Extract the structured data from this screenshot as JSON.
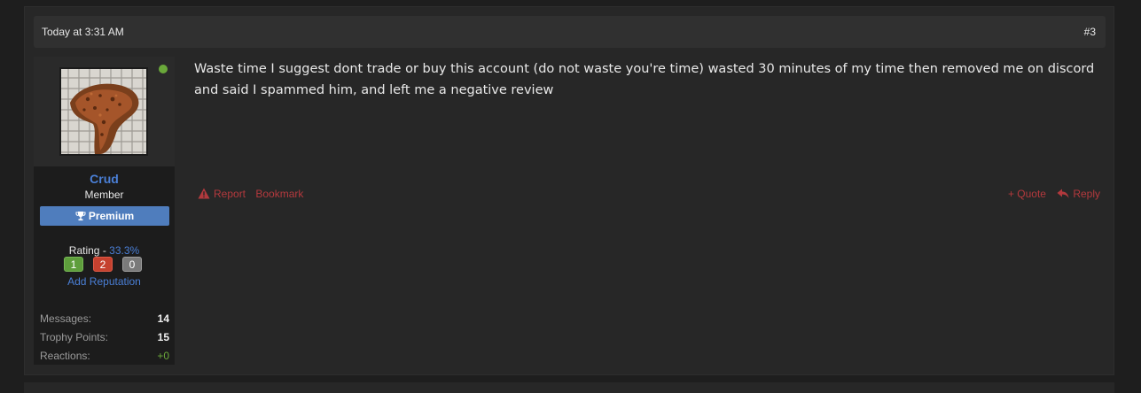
{
  "post": {
    "date": "Today at 3:31 AM",
    "number": "#3",
    "body": "Waste time I suggest dont trade or buy this account (do not waste you're time) wasted 30 minutes of my time then removed me on discord and said I spammed him, and left me a negative review"
  },
  "user": {
    "name": "Crud",
    "title": "Member",
    "badge": "Premium",
    "rating_label": "Rating - ",
    "rating_value": "33.3%",
    "rep": {
      "positive": "1",
      "negative": "2",
      "neutral": "0"
    },
    "add_reputation": "Add Reputation",
    "stats": [
      {
        "label": "Messages:",
        "value": "14"
      },
      {
        "label": "Trophy Points:",
        "value": "15"
      },
      {
        "label": "Reactions:",
        "value": "+0"
      }
    ]
  },
  "actions": {
    "report": "Report",
    "bookmark": "Bookmark",
    "quote": "+ Quote",
    "reply": "Reply"
  },
  "colors": {
    "accent": "#4a7fd6",
    "action": "#b3393d",
    "online": "#6aa83a"
  }
}
